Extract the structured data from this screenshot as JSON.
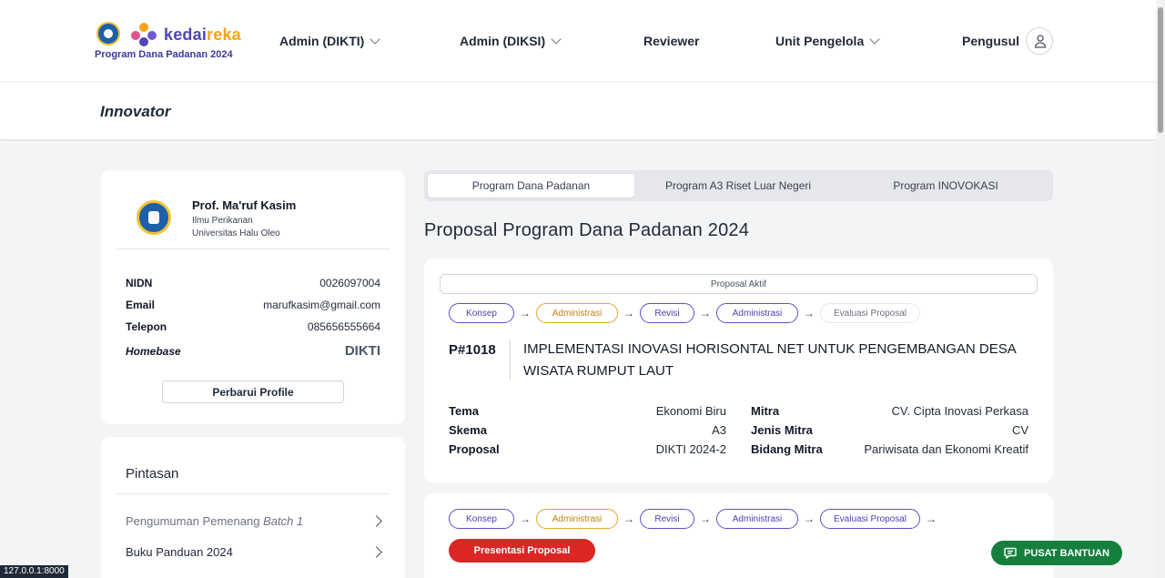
{
  "header": {
    "brand_prefix": "kedai",
    "brand_suffix": "reka",
    "subtitle": "Program Dana Padanan 2024",
    "nav": [
      {
        "label": "Admin (DIKTI)"
      },
      {
        "label": "Admin (DIKSI)"
      },
      {
        "label": "Reviewer"
      },
      {
        "label": "Unit Pengelola"
      },
      {
        "label": "Pengusul"
      }
    ]
  },
  "page": {
    "title": "Innovator"
  },
  "profile": {
    "name": "Prof. Ma'ruf Kasim",
    "department": "Ilmu Perikanan",
    "university": "Universitas Halu Oleo",
    "fields": [
      {
        "label": "NIDN",
        "value": "0026097004"
      },
      {
        "label": "Email",
        "value": "marufkasim@gmail.com"
      },
      {
        "label": "Telepon",
        "value": "085656555664"
      },
      {
        "label": "Homebase",
        "value": "DIKTI"
      }
    ],
    "update_button": "Perbarui Profile"
  },
  "shortcuts": {
    "title": "Pintasan",
    "items": [
      {
        "label": "Pengumuman Pemenang",
        "label_italic": "Batch 1"
      },
      {
        "label": "Buku Panduan 2024",
        "label_italic": ""
      }
    ]
  },
  "tabs": [
    {
      "label": "Program Dana Padanan"
    },
    {
      "label": "Program A3 Riset Luar Negeri"
    },
    {
      "label": "Program INOVOKASI"
    }
  ],
  "section_title": "Proposal Program Dana Padanan 2024",
  "proposal1": {
    "status_label": "Proposal Aktif",
    "steps": [
      "Konsep",
      "Administrasi",
      "Revisi",
      "Administrasi",
      "Evaluasi Proposal"
    ],
    "id": "P#1018",
    "title": "IMPLEMENTASI INOVASI HORISONTAL NET UNTUK PENGEMBANGAN DESA WISATA RUMPUT LAUT",
    "details_left": [
      {
        "label": "Tema",
        "value": "Ekonomi Biru"
      },
      {
        "label": "Skema",
        "value": "A3"
      },
      {
        "label": "Proposal",
        "value": "DIKTI 2024-2"
      }
    ],
    "details_right": [
      {
        "label": "Mitra",
        "value": "CV. Cipta Inovasi Perkasa"
      },
      {
        "label": "Jenis Mitra",
        "value": "CV"
      },
      {
        "label": "Bidang Mitra",
        "value": "Pariwisata dan Ekonomi Kreatif"
      }
    ]
  },
  "proposal2": {
    "steps": [
      "Konsep",
      "Administrasi",
      "Revisi",
      "Administrasi",
      "Evaluasi Proposal"
    ],
    "action_button": "Presentasi Proposal"
  },
  "help_button": "PUSAT BANTUAN",
  "status_url": "127.0.0.1:8000",
  "colors": {
    "accent": "#4f46b8",
    "gold": "#e0a82e",
    "danger": "#dc2626",
    "success": "#15803d"
  }
}
